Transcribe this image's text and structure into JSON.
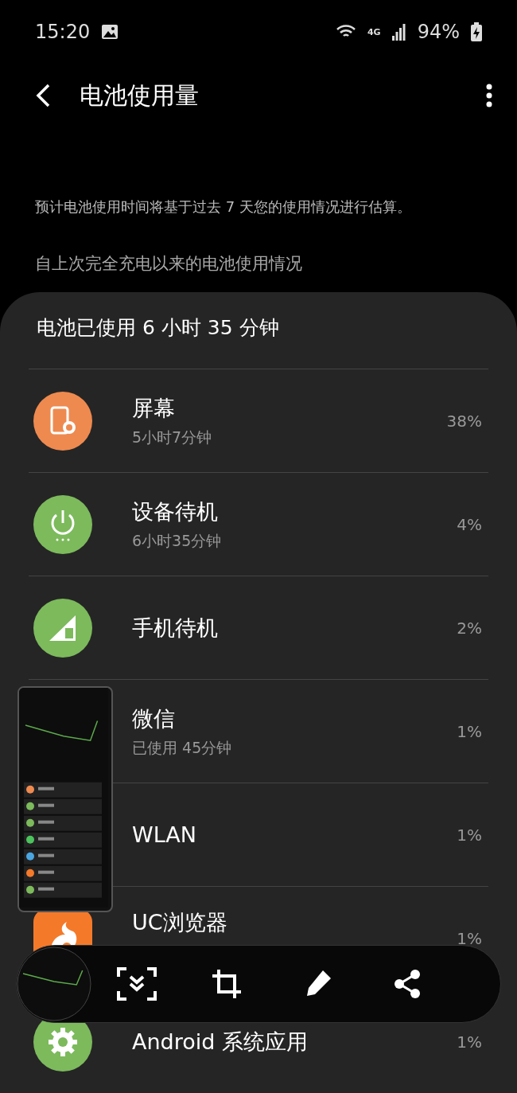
{
  "status_bar": {
    "time": "15:20",
    "network_type": "4G",
    "battery": "94%"
  },
  "header": {
    "title": "电池使用量"
  },
  "note": "预计电池使用时间将基于过去 7 天您的使用情况进行估算。",
  "section_title": "自上次完全充电以来的电池使用情况",
  "usage_card": {
    "title": "电池已使用 6 小时 35 分钟",
    "items": [
      {
        "name": "屏幕",
        "detail": "5小时7分钟",
        "percent": "38%",
        "kind": "screen",
        "color": "#ee8a4f"
      },
      {
        "name": "设备待机",
        "detail": "6小时35分钟",
        "percent": "4%",
        "kind": "power",
        "color": "#7cba5c"
      },
      {
        "name": "手机待机",
        "percent": "2%",
        "kind": "signal",
        "color": "#7cba5c"
      },
      {
        "name": "微信",
        "detail": "已使用 45分钟",
        "percent": "1%",
        "kind": "hidden"
      },
      {
        "name": "WLAN",
        "percent": "1%",
        "kind": "hidden"
      },
      {
        "name": "UC浏览器",
        "percent": "1%",
        "kind": "uc",
        "color": "#f47a2a"
      },
      {
        "name": "Android 系统应用",
        "percent": "1%",
        "kind": "gear",
        "color": "#7cba5c"
      }
    ]
  },
  "screenshot_toolbar": {
    "actions": [
      {
        "kind": "scroll"
      },
      {
        "kind": "crop"
      },
      {
        "kind": "edit"
      },
      {
        "kind": "share"
      }
    ]
  }
}
